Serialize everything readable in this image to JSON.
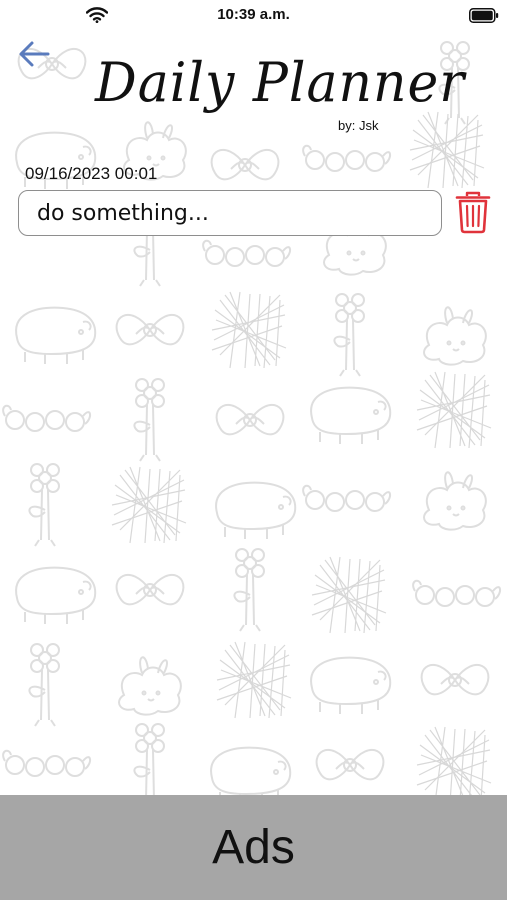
{
  "status_bar": {
    "time": "10:39 a.m.",
    "wifi_icon": "wifi-icon",
    "battery_icon": "battery-icon"
  },
  "header": {
    "back_icon": "arrow-left-icon",
    "title": "Daily Planner",
    "byline": "by: Jsk"
  },
  "task": {
    "date": "09/16/2023 00:01",
    "text": "do something...",
    "delete_icon": "trash-icon"
  },
  "ads": {
    "label": "Ads"
  },
  "colors": {
    "accent": "#5a7bbd",
    "delete": "#e0333b",
    "ads_background": "#a6a6a6",
    "doodle_stroke": "#e2e2e2"
  }
}
